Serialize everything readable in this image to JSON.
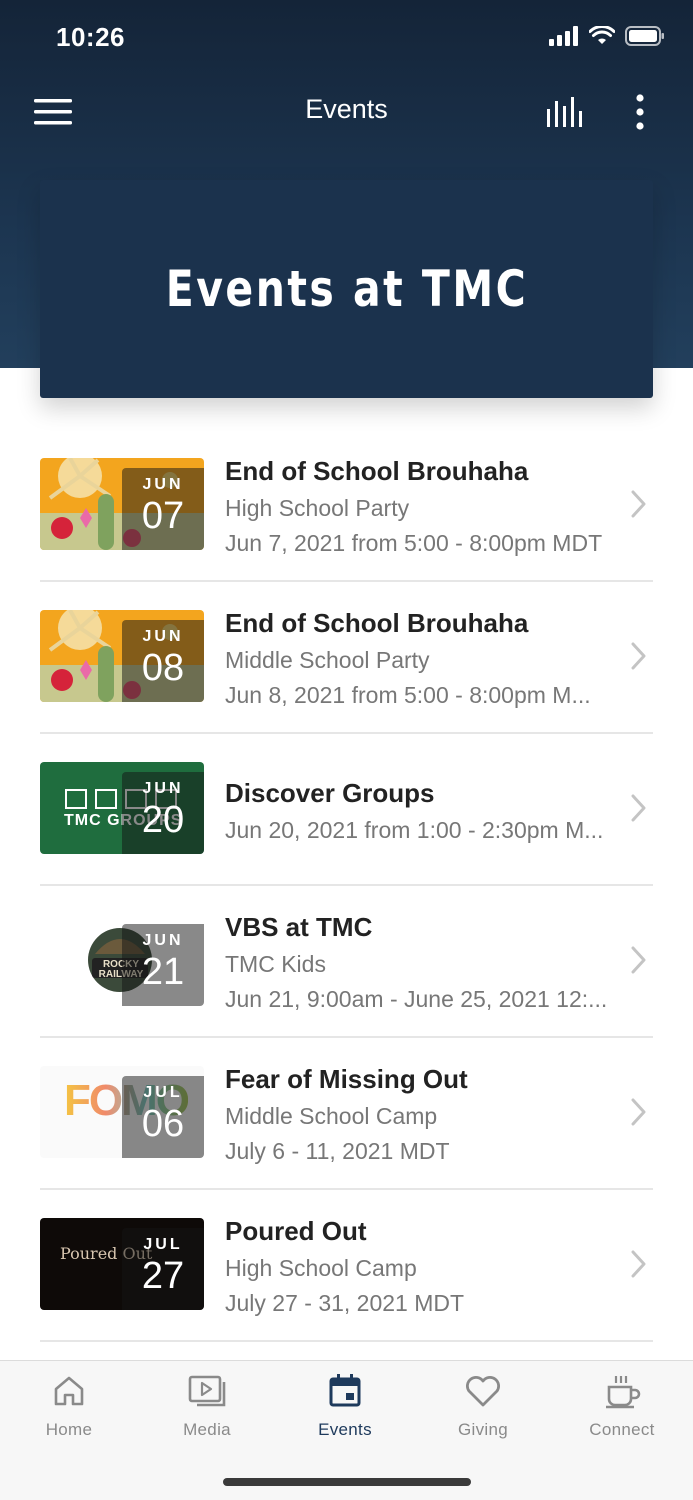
{
  "status": {
    "time": "10:26"
  },
  "nav": {
    "title": "Events",
    "menu_icon": "hamburger-menu-icon",
    "stats_icon": "bar-levels-icon",
    "more_icon": "more-vertical-icon"
  },
  "banner": {
    "title": "Events at TMC"
  },
  "events": [
    {
      "month": "JUN",
      "day": "07",
      "title": "End of School Brouhaha",
      "subtitle": "High School Party",
      "when": "Jun 7, 2021 from 5:00 - 8:00pm MDT",
      "thumb": "tropical-flowers"
    },
    {
      "month": "JUN",
      "day": "08",
      "title": "End of School Brouhaha",
      "subtitle": "Middle School Party",
      "when": "Jun 8, 2021 from 5:00 - 8:00pm M...",
      "thumb": "tropical-flowers"
    },
    {
      "month": "JUN",
      "day": "20",
      "title": "Discover Groups",
      "subtitle": "",
      "when": "Jun 20, 2021 from 1:00 - 2:30pm M...",
      "thumb": "tmc-groups",
      "thumb_text": "TMC GROUPS"
    },
    {
      "month": "JUN",
      "day": "21",
      "title": "VBS at TMC",
      "subtitle": "TMC Kids",
      "when": "Jun 21, 9:00am - June 25, 2021 12:...",
      "thumb": "rocky-railway",
      "thumb_text": "ROCKY RAILWAY"
    },
    {
      "month": "JUL",
      "day": "06",
      "title": "Fear of Missing Out",
      "subtitle": "Middle School Camp",
      "when": "July 6 - 11, 2021 MDT",
      "thumb": "fomo",
      "thumb_text": "FOMO"
    },
    {
      "month": "JUL",
      "day": "27",
      "title": "Poured Out",
      "subtitle": "High School Camp",
      "when": "July 27 - 31, 2021 MDT",
      "thumb": "poured-out",
      "thumb_text": "Poured Out"
    }
  ],
  "tabs": [
    {
      "label": "Home",
      "icon": "home-icon"
    },
    {
      "label": "Media",
      "icon": "media-play-icon"
    },
    {
      "label": "Events",
      "icon": "calendar-icon",
      "active": true
    },
    {
      "label": "Giving",
      "icon": "heart-icon"
    },
    {
      "label": "Connect",
      "icon": "coffee-cup-icon"
    }
  ],
  "colors": {
    "header": "#1b324d",
    "accent": "#1e3a5c",
    "tab_inactive": "#8a8a8a"
  }
}
